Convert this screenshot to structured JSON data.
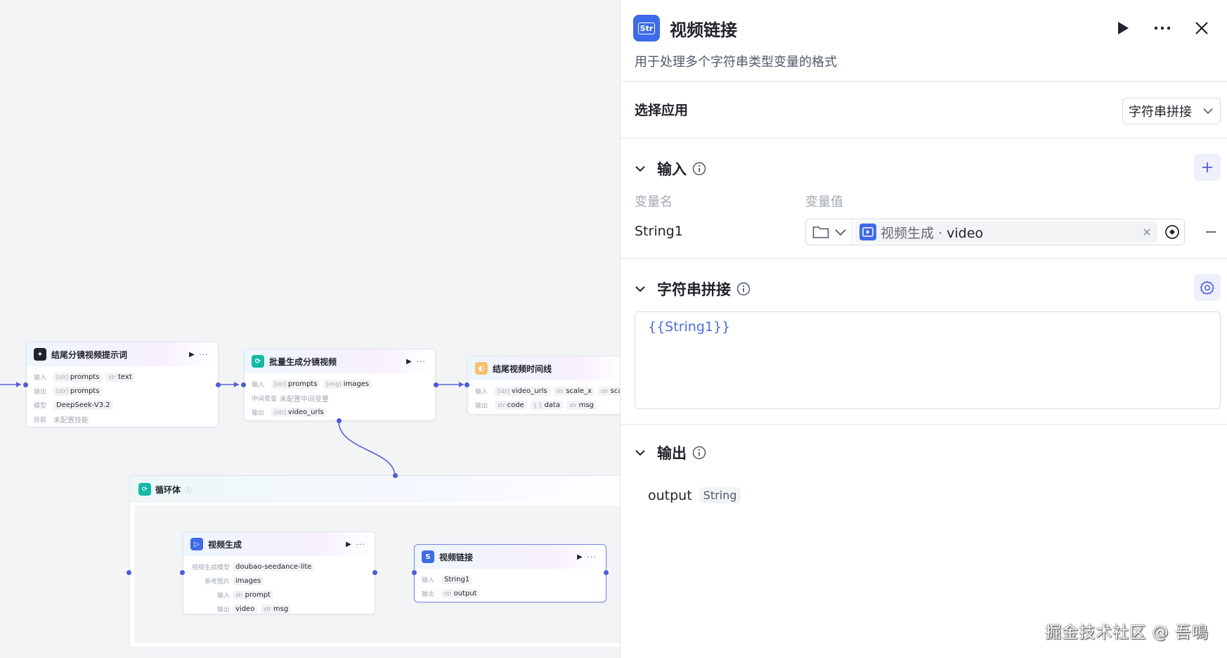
{
  "canvas": {
    "nodes": {
      "n1": {
        "title": "结尾分镜视频提示词",
        "rows": [
          {
            "label": "输入",
            "chips": [
              {
                "t": "[str]",
                "v": "prompts"
              },
              {
                "t": "str",
                "v": "text"
              }
            ]
          },
          {
            "label": "输出",
            "chips": [
              {
                "t": "[str]",
                "v": "prompts"
              }
            ]
          },
          {
            "label": "模型",
            "chips": [
              {
                "t": "",
                "v": "DeepSeek-V3.2"
              }
            ]
          },
          {
            "label": "技能",
            "text": "未配置技能"
          }
        ]
      },
      "n2": {
        "title": "批量生成分镜视频",
        "rows": [
          {
            "label": "输入",
            "chips": [
              {
                "t": "[str]",
                "v": "prompts"
              },
              {
                "t": "[img]",
                "v": "images"
              }
            ]
          },
          {
            "label": "中间变量",
            "text": "未配置中间变量"
          },
          {
            "label": "输出",
            "chips": [
              {
                "t": "[str]",
                "v": "video_urls"
              }
            ]
          }
        ]
      },
      "n3": {
        "title": "结尾视频时间线",
        "rows": [
          {
            "label": "输入",
            "chips": [
              {
                "t": "[str]",
                "v": "video_urls"
              },
              {
                "t": "str",
                "v": "scale_x"
              },
              {
                "t": "str",
                "v": "scale_y"
              }
            ]
          },
          {
            "label": "输出",
            "chips": [
              {
                "t": "str",
                "v": "code"
              },
              {
                "t": "{ }",
                "v": "data"
              },
              {
                "t": "str",
                "v": "msg"
              }
            ]
          }
        ]
      },
      "loop": {
        "title": "循环体"
      },
      "n4": {
        "title": "视频生成",
        "rows": [
          {
            "label": "视频生成模型",
            "chips": [
              {
                "t": "",
                "v": "doubao-seedance-lite"
              }
            ]
          },
          {
            "label": "参考图片",
            "chips": [
              {
                "t": "",
                "v": "images"
              }
            ]
          },
          {
            "label": "输入",
            "chips": [
              {
                "t": "str",
                "v": "prompt"
              }
            ]
          },
          {
            "label": "输出",
            "chips": [
              {
                "t": "",
                "v": "video"
              },
              {
                "t": "str",
                "v": "msg"
              }
            ]
          }
        ]
      },
      "n5": {
        "title": "视频链接",
        "rows": [
          {
            "label": "输入",
            "chips": [
              {
                "t": "",
                "v": "String1"
              }
            ]
          },
          {
            "label": "输出",
            "chips": [
              {
                "t": "str",
                "v": "output"
              }
            ]
          }
        ]
      }
    }
  },
  "panel": {
    "title": "视频链接",
    "icon_text": "Str",
    "description": "用于处理多个字符串类型变量的格式",
    "select_app": {
      "label": "选择应用",
      "value": "字符串拼接"
    },
    "input": {
      "title": "输入",
      "col_name": "变量名",
      "col_value": "变量值",
      "var_name": "String1",
      "ref_node": "视频生成",
      "ref_sep": " · ",
      "ref_field": "video"
    },
    "concat": {
      "title": "字符串拼接",
      "template": "{{String1}}"
    },
    "output": {
      "title": "输出",
      "name": "output",
      "type": "String"
    }
  },
  "watermark": "掘金技术社区 @ 吾鳴",
  "colors": {
    "accent": "#4e5bd6",
    "brand_blue": "#3f6ae8",
    "wire": "#5b5fd6"
  }
}
